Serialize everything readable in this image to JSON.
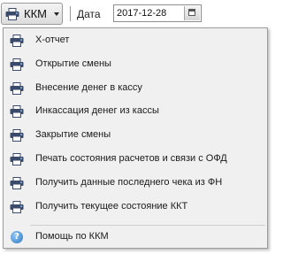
{
  "toolbar": {
    "kkm_label": "ККМ",
    "date_label": "Дата",
    "date_value": "2017-12-28"
  },
  "menu": {
    "items": [
      {
        "label": "X-отчет",
        "icon": "printer-icon"
      },
      {
        "label": "Открытие смены",
        "icon": "printer-icon"
      },
      {
        "label": "Внесение денег в кассу",
        "icon": "printer-icon"
      },
      {
        "label": "Инкассация денег из кассы",
        "icon": "printer-icon"
      },
      {
        "label": "Закрытие смены",
        "icon": "printer-icon"
      },
      {
        "label": "Печать состояния расчетов и связи с ОФД",
        "icon": "printer-icon"
      },
      {
        "label": "Получить данные последнего чека из ФН",
        "icon": "printer-icon"
      },
      {
        "label": "Получить текущее состояние ККТ",
        "icon": "printer-icon"
      }
    ],
    "help": {
      "label": "Помощь по ККМ",
      "icon": "help-icon"
    }
  },
  "colors": {
    "menu_background": "#f0f0f0",
    "help_icon": "#2f79c3",
    "printer_dark": "#3a4a6a"
  }
}
